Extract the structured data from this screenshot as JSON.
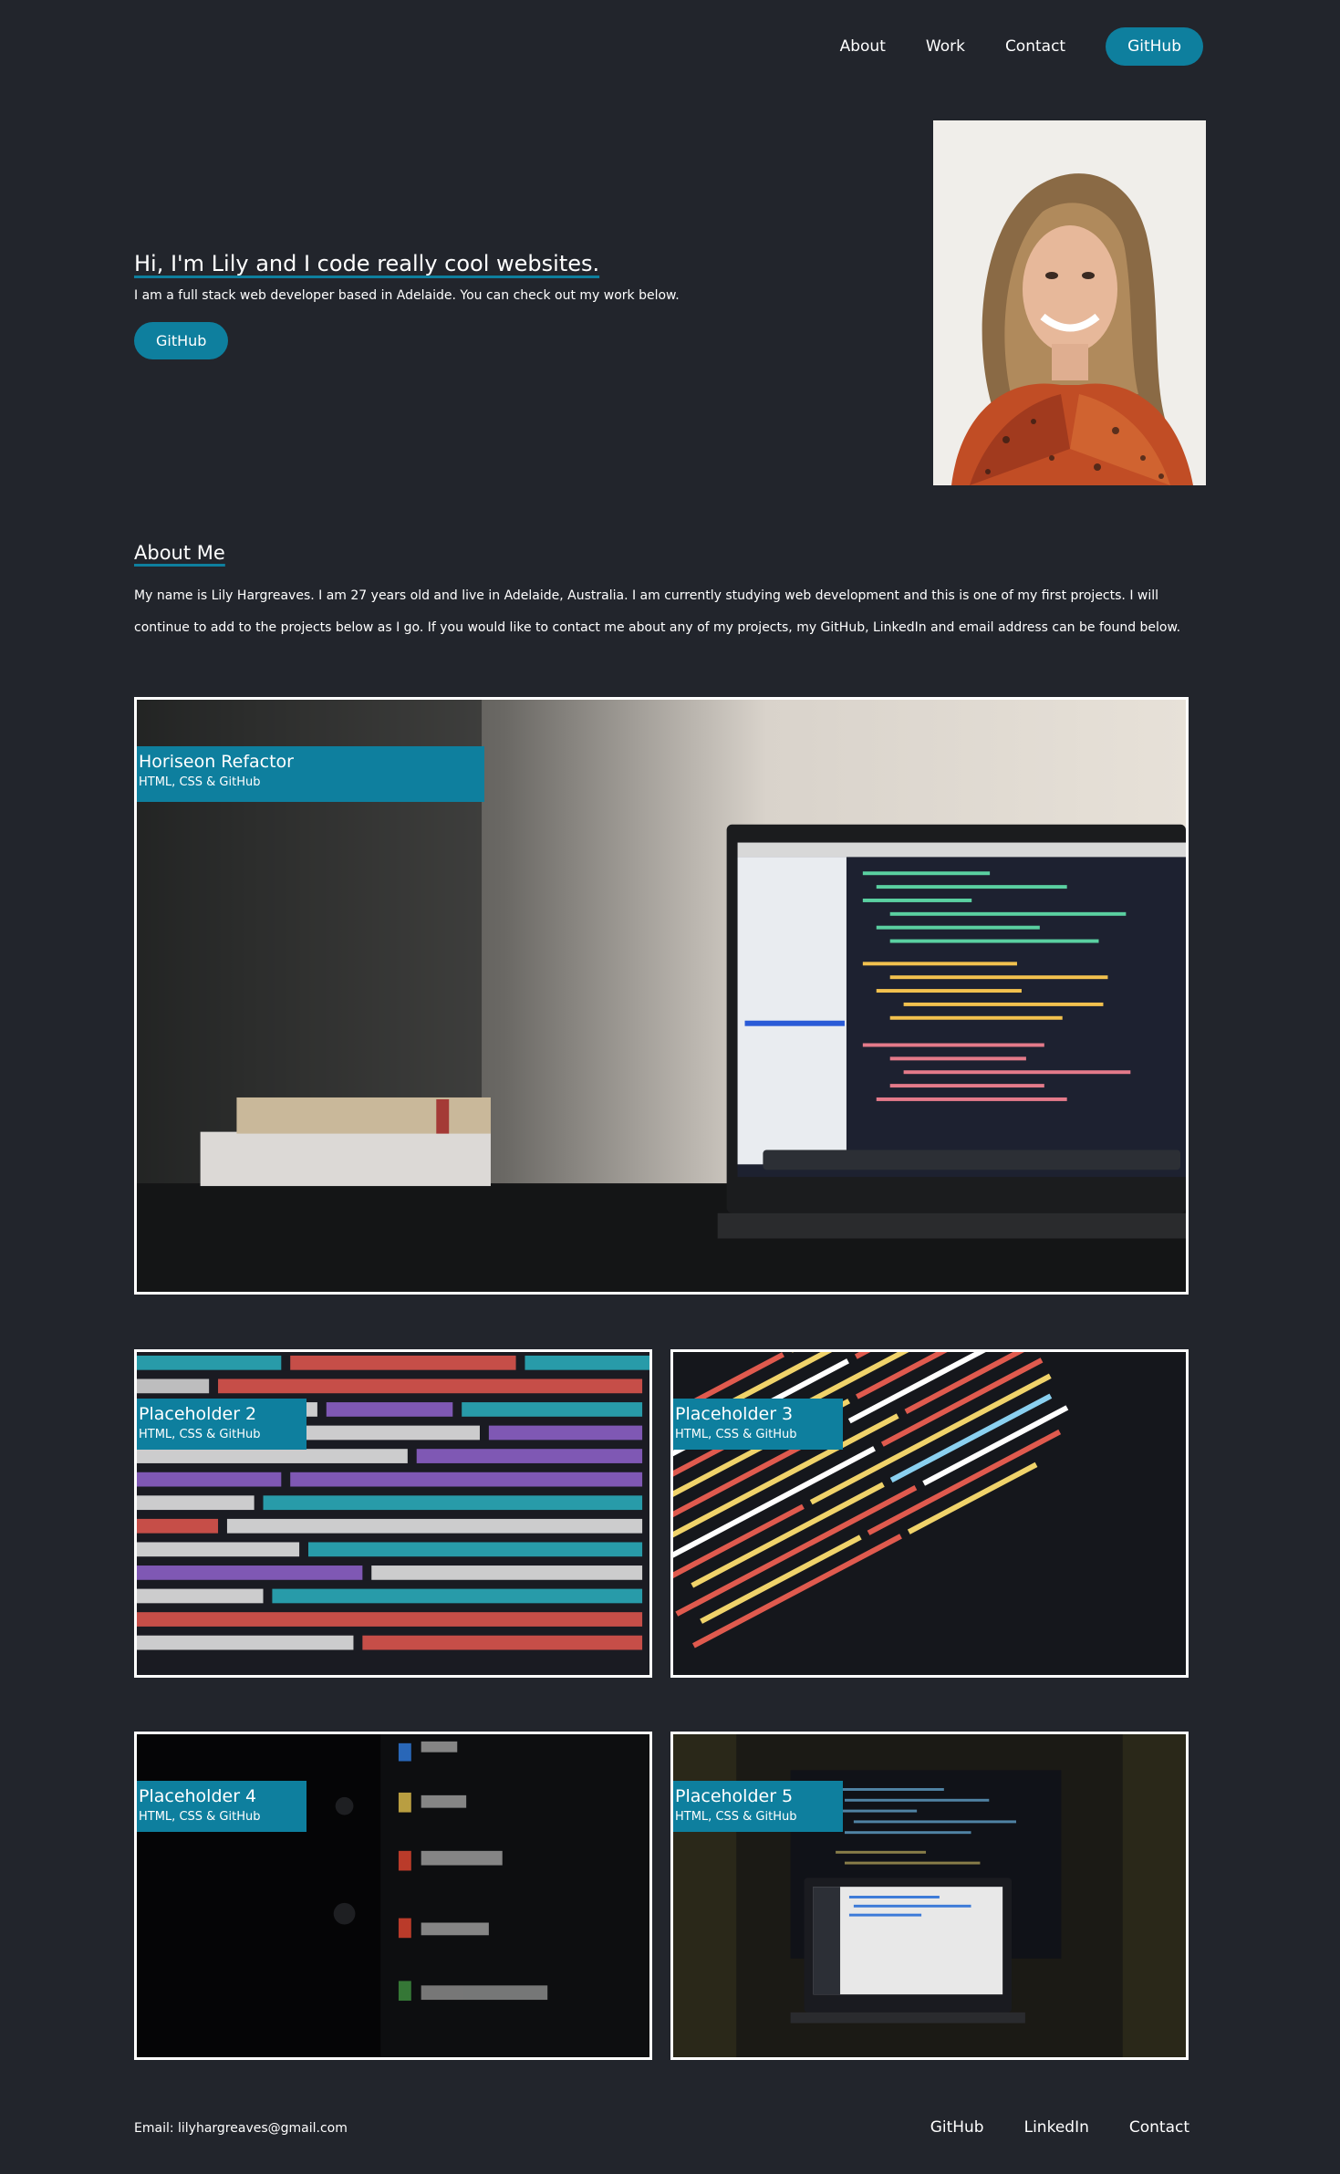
{
  "nav": {
    "items": [
      {
        "label": "About"
      },
      {
        "label": "Work"
      },
      {
        "label": "Contact"
      }
    ],
    "github_label": "GitHub"
  },
  "hero": {
    "title": "Hi, I'm Lily and I code really cool websites.",
    "subtitle": "I am a full stack web developer based in Adelaide. You can check out my work below.",
    "button_label": "GitHub",
    "portrait_icon": "portrait-photo"
  },
  "about": {
    "title": "About Me",
    "body": "My name is Lily Hargreaves. I am 27 years old and live in Adelaide, Australia. I am currently studying web development and this is one of my first projects. I will continue to add to the projects below as I go. If you would like to contact me about any of my projects, my GitHub, LinkedIn and email address can be found below."
  },
  "projects": [
    {
      "title": "Horiseon Refactor",
      "tech": "HTML, CSS & GitHub"
    },
    {
      "title": "Placeholder 2",
      "tech": "HTML, CSS & GitHub"
    },
    {
      "title": "Placeholder 3",
      "tech": "HTML, CSS & GitHub"
    },
    {
      "title": "Placeholder 4",
      "tech": "HTML, CSS & GitHub"
    },
    {
      "title": "Placeholder 5",
      "tech": "HTML, CSS & GitHub"
    }
  ],
  "footer": {
    "email": "Email: lilyhargreaves@gmail.com",
    "links": [
      {
        "label": "GitHub"
      },
      {
        "label": "LinkedIn"
      },
      {
        "label": "Contact"
      }
    ]
  },
  "colors": {
    "background": "#22252c",
    "accent": "#0e7f9e",
    "text": "#ffffff"
  }
}
